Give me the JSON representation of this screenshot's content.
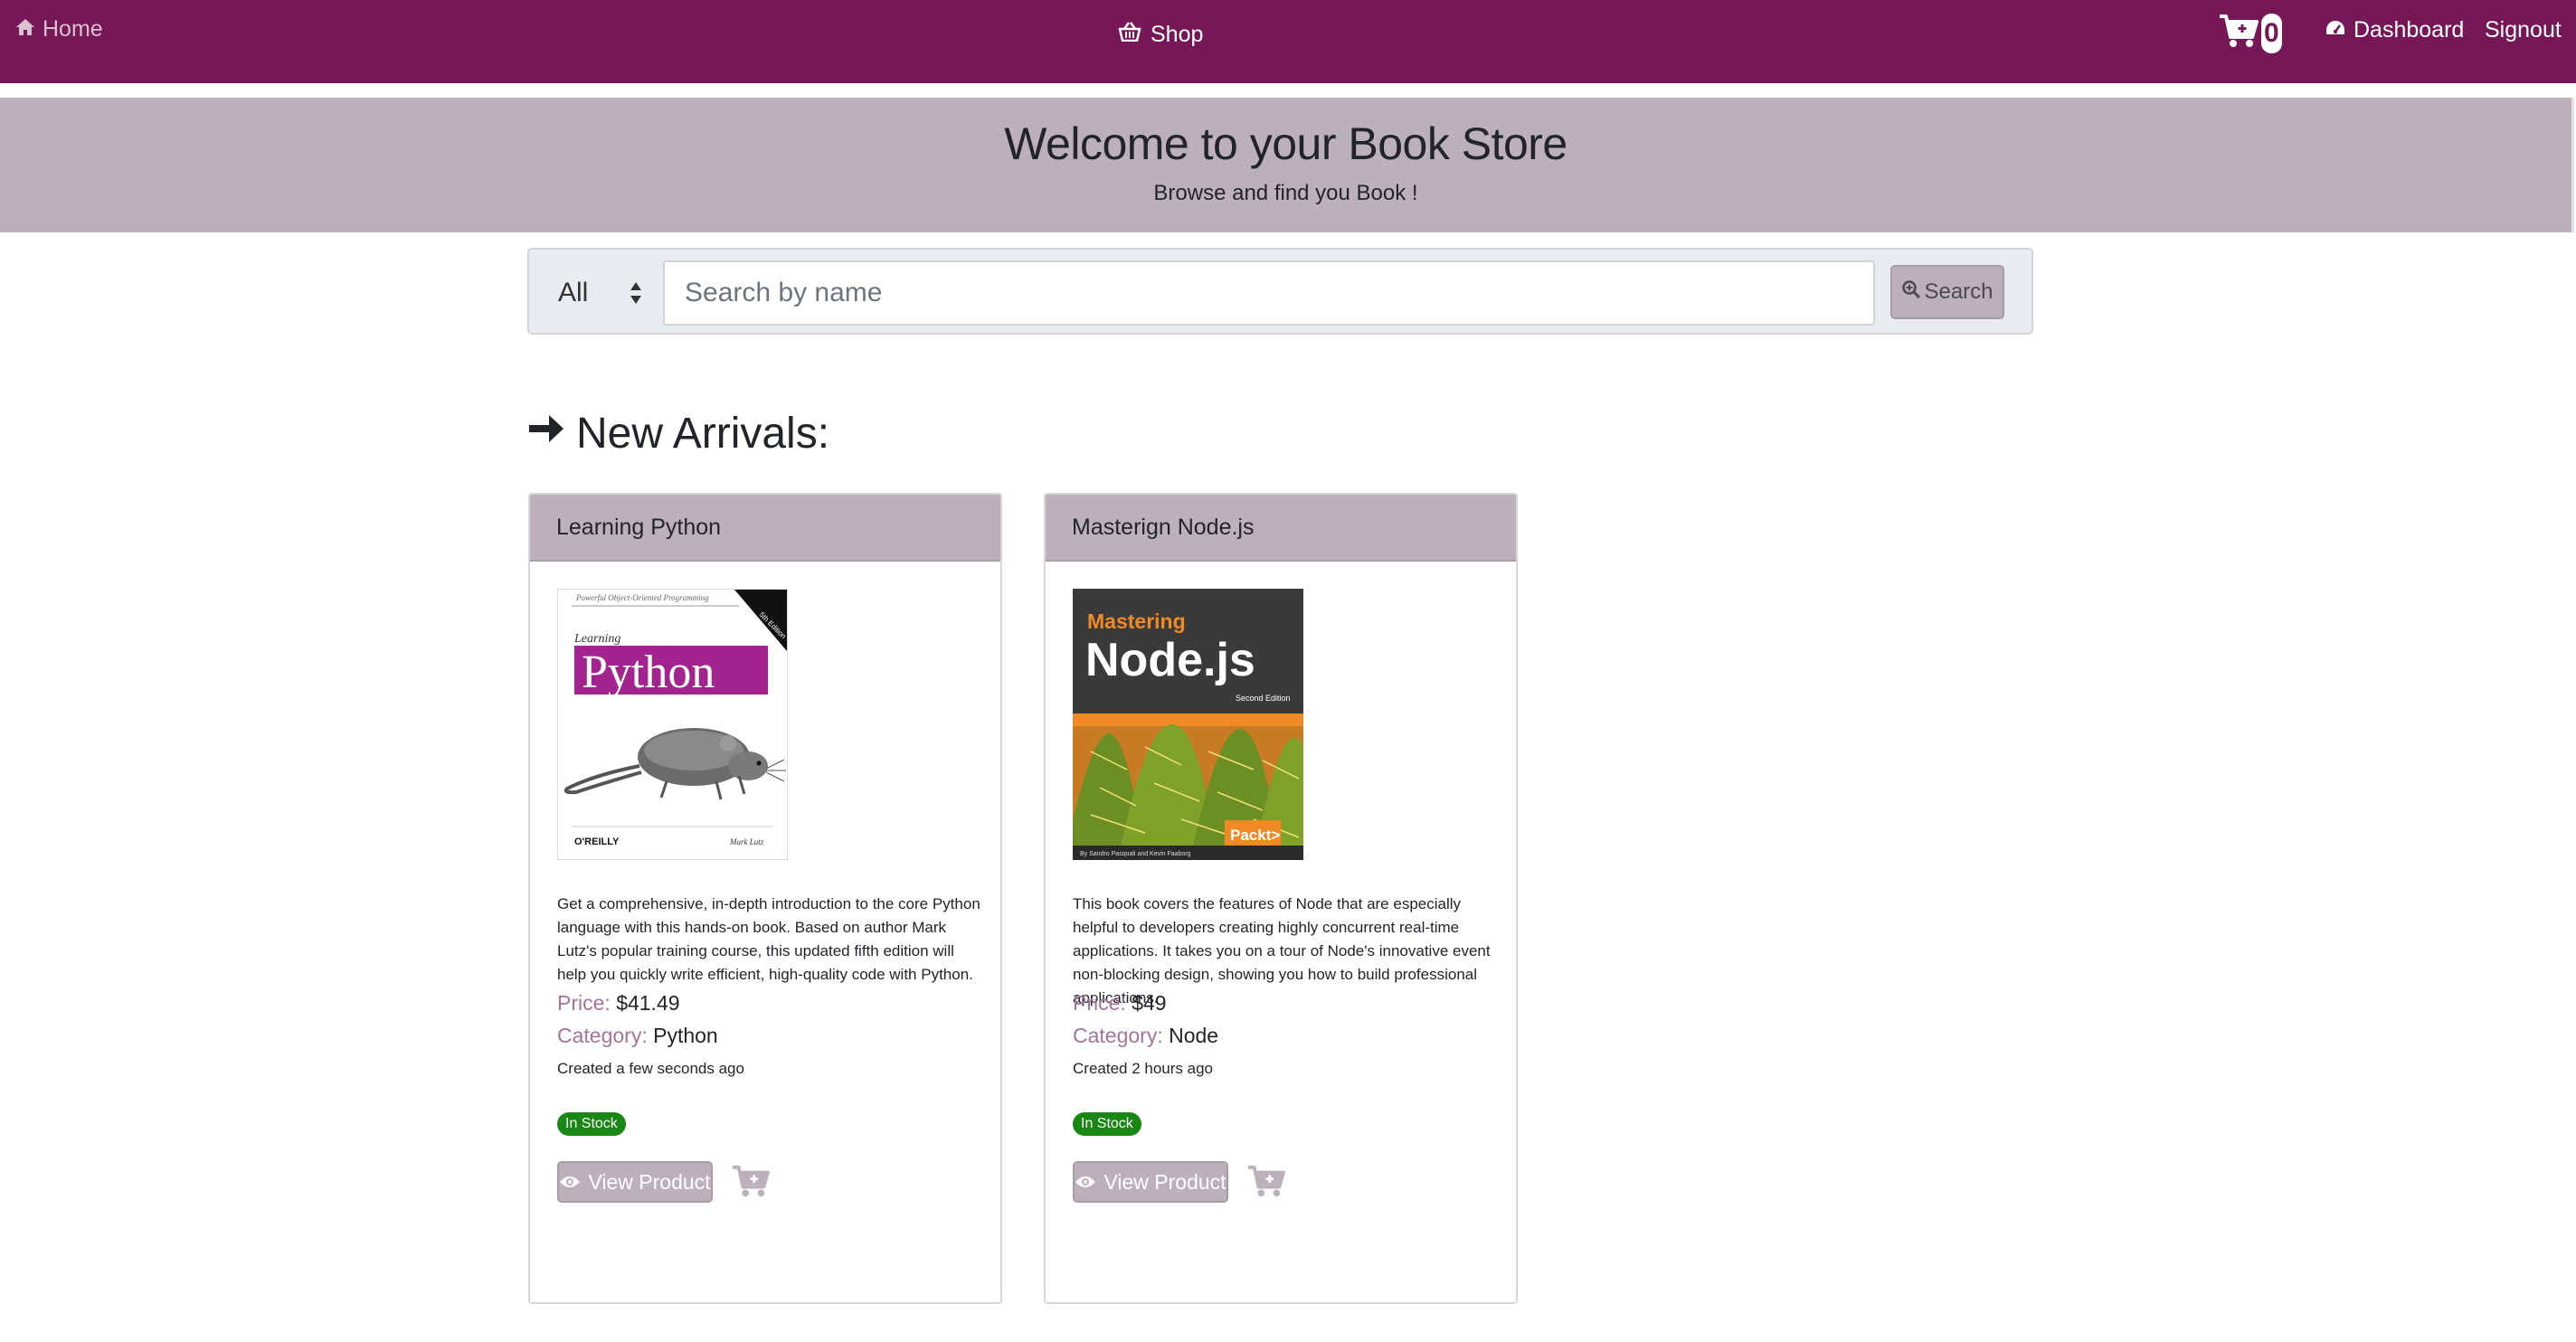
{
  "nav": {
    "home_label": "Home",
    "shop_label": "Shop",
    "cart_count": "0",
    "dashboard_label": "Dashboard",
    "signout_label": "Signout"
  },
  "hero": {
    "title": "Welcome to your Book Store",
    "subtitle": "Browse and find you Book !"
  },
  "search": {
    "category_selected": "All",
    "placeholder": "Search by name",
    "button_label": "Search"
  },
  "section": {
    "title": "New Arrivals:"
  },
  "products": [
    {
      "title": "Learning Python",
      "description": "Get a comprehensive, in-depth introduction to the core Python language with this hands-on book. Based on author Mark Lutz's popular training course, this updated fifth edition will help you quickly write efficient, high-quality code with Python.",
      "price_label": "Price:",
      "price": "$41.49",
      "category_label": "Category:",
      "category": "Python",
      "created": "Created a few seconds ago",
      "stock": "In Stock",
      "view_label": "View Product",
      "cover": {
        "series": "Powerful Object-Oriented Programming",
        "subtitle": "Learning",
        "title": "Python",
        "edition": "5th Edition",
        "publisher": "O'REILLY",
        "author": "Mark Lutz"
      }
    },
    {
      "title": "Masterign Node.js",
      "description": "This book covers the features of Node that are especially helpful to developers creating highly concurrent real-time applications. It takes you on a tour of Node's innovative event non-blocking design, showing you how to build professional applications.",
      "price_label": "Price:",
      "price": "$49",
      "category_label": "Category:",
      "category": "Node",
      "created": "Created 2 hours ago",
      "stock": "In Stock",
      "view_label": "View Product",
      "cover": {
        "subtitle": "Mastering",
        "title": "Node.js",
        "edition": "Second Edition",
        "publisher": "Packt>",
        "authors": "By Sandro Pasquali and Kevin Faaborg"
      }
    }
  ],
  "colors": {
    "navbar": "#761757",
    "hero": "#bcb0ba",
    "accent_label": "#a37598",
    "stock_badge": "#198714"
  },
  "icons": [
    "home-icon",
    "shop-basket-icon",
    "cart-icon",
    "dashboard-icon",
    "search-icon",
    "arrow-right-icon",
    "eye-icon",
    "add-to-cart-icon"
  ]
}
